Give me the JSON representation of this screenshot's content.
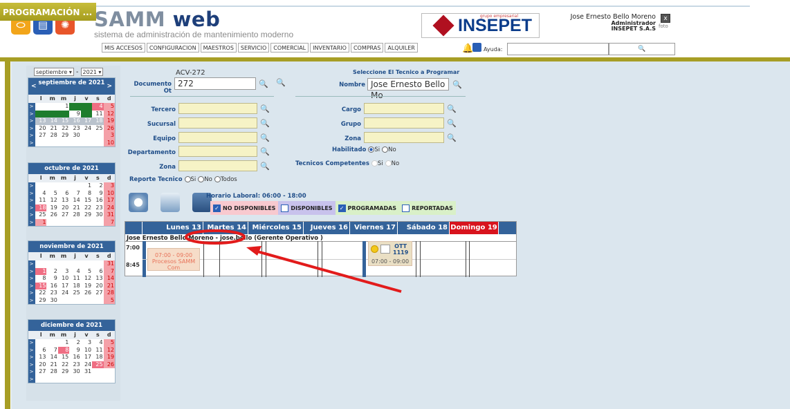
{
  "brand": {
    "title_a": "SAMM",
    "title_b": " web",
    "subtitle": "sistema de administración de mantenimiento moderno"
  },
  "insepet": {
    "grupo": "grupo empresarial",
    "name": "INSEPET"
  },
  "user": {
    "name": "Jose Ernesto Bello Moreno",
    "role": "Administrador",
    "company": "INSEPET S.A.S",
    "photo_alt": "foto"
  },
  "nav": {
    "active_tab": "PROGRAMACIÓN ...",
    "items": [
      "MIS ACCESOS",
      "CONFIGURACION",
      "MAESTROS",
      "SERVICIO",
      "COMERCIAL",
      "INVENTARIO",
      "COMPRAS",
      "ALQUILER"
    ],
    "help_label": "Ayuda:"
  },
  "calendar": {
    "month_select": "septiembre",
    "year_select": "2021",
    "weekday_labels": [
      "l",
      "m",
      "m",
      "j",
      "v",
      "s",
      "d"
    ],
    "months": [
      {
        "title": "septiembre de 2021",
        "rows": [
          [
            "",
            "",
            "1",
            "2",
            "3",
            "4",
            "5"
          ],
          [
            "6",
            "7",
            "8",
            "9",
            "10",
            "11",
            "12"
          ],
          [
            "13",
            "14",
            "15",
            "16",
            "17",
            "18",
            "19"
          ],
          [
            "20",
            "21",
            "22",
            "23",
            "24",
            "25",
            "26"
          ],
          [
            "27",
            "28",
            "29",
            "30",
            "",
            "",
            "3"
          ],
          [
            "",
            "",
            "",
            "",
            "",
            "",
            "10"
          ]
        ]
      },
      {
        "title": "octubre de 2021",
        "rows": [
          [
            "",
            "",
            "",
            "",
            "",
            "1",
            "2",
            "3"
          ],
          [
            "4",
            "5",
            "6",
            "7",
            "8",
            "9",
            "10"
          ],
          [
            "11",
            "12",
            "13",
            "14",
            "15",
            "16",
            "17"
          ],
          [
            "18",
            "19",
            "20",
            "21",
            "22",
            "23",
            "24"
          ],
          [
            "25",
            "26",
            "27",
            "28",
            "29",
            "30",
            "31"
          ],
          [
            "1",
            "",
            "",
            "",
            "",
            "",
            "7"
          ]
        ]
      },
      {
        "title": "noviembre de 2021",
        "rows": [
          [
            "",
            "",
            "",
            "",
            "",
            "",
            "31"
          ],
          [
            "1",
            "2",
            "3",
            "4",
            "5",
            "6",
            "7"
          ],
          [
            "8",
            "9",
            "10",
            "11",
            "12",
            "13",
            "14"
          ],
          [
            "15",
            "16",
            "17",
            "18",
            "19",
            "20",
            "21"
          ],
          [
            "22",
            "23",
            "24",
            "25",
            "26",
            "27",
            "28"
          ],
          [
            "29",
            "30",
            "",
            "",
            "",
            "",
            "5"
          ]
        ]
      },
      {
        "title": "diciembre de 2021",
        "rows": [
          [
            "",
            "",
            "1",
            "2",
            "3",
            "4",
            "5"
          ],
          [
            "6",
            "7",
            "8",
            "9",
            "10",
            "11",
            "12"
          ],
          [
            "13",
            "14",
            "15",
            "16",
            "17",
            "18",
            "19"
          ],
          [
            "20",
            "21",
            "22",
            "23",
            "24",
            "25",
            "26"
          ],
          [
            "27",
            "28",
            "29",
            "30",
            "31",
            "",
            ""
          ],
          [
            "",
            "",
            "",
            "",
            "",
            "",
            ""
          ]
        ]
      }
    ]
  },
  "form": {
    "doc_code": "ACV-272",
    "doc_label": "Documento Ot",
    "doc_value": "272",
    "tercero": "Tercero",
    "sucursal": "Sucursal",
    "equipo": "Equipo",
    "departamento": "Departamento",
    "zona": "Zona",
    "reporte": "Reporte Tecnico",
    "si": "Si",
    "no": "No",
    "todos": "Todos",
    "select_tech": "Seleccione El Tecnico a Programar",
    "nombre_label": "Nombre",
    "nombre_value": "Jose Ernesto Bello Mo",
    "cargo": "Cargo",
    "grupo": "Grupo",
    "zona2": "Zona",
    "habilitado": "Habilitado",
    "tecnicos": "Tecnicos Competentes"
  },
  "schedule": {
    "horario": "Horario Laboral: 06:00 - 18:00",
    "legend": {
      "no_disp": "NO DISPONIBLES",
      "disp": "DISPONIBLES",
      "prog": "PROGRAMADAS",
      "rep": "REPORTADAS"
    },
    "days": [
      "Lunes 13",
      "Martes 14",
      "Miércoles 15",
      "Jueves 16",
      "Viernes 17",
      "Sábado 18",
      "Domingo 19"
    ],
    "tech_line": "Jose Ernesto Bello Moreno - jose.bello (Gerente Operativo )",
    "time1": "7:00",
    "time2": "8:45",
    "event1": {
      "time": "07:00 - 09:00",
      "title": "Procesos SAMM Com"
    },
    "event2": {
      "code_a": "OTT",
      "code_b": "1119",
      "time": "07:00 - 09:00"
    }
  },
  "colors": {
    "olive": "#a79e25",
    "navy": "#34639a",
    "red": "#d8131d"
  }
}
